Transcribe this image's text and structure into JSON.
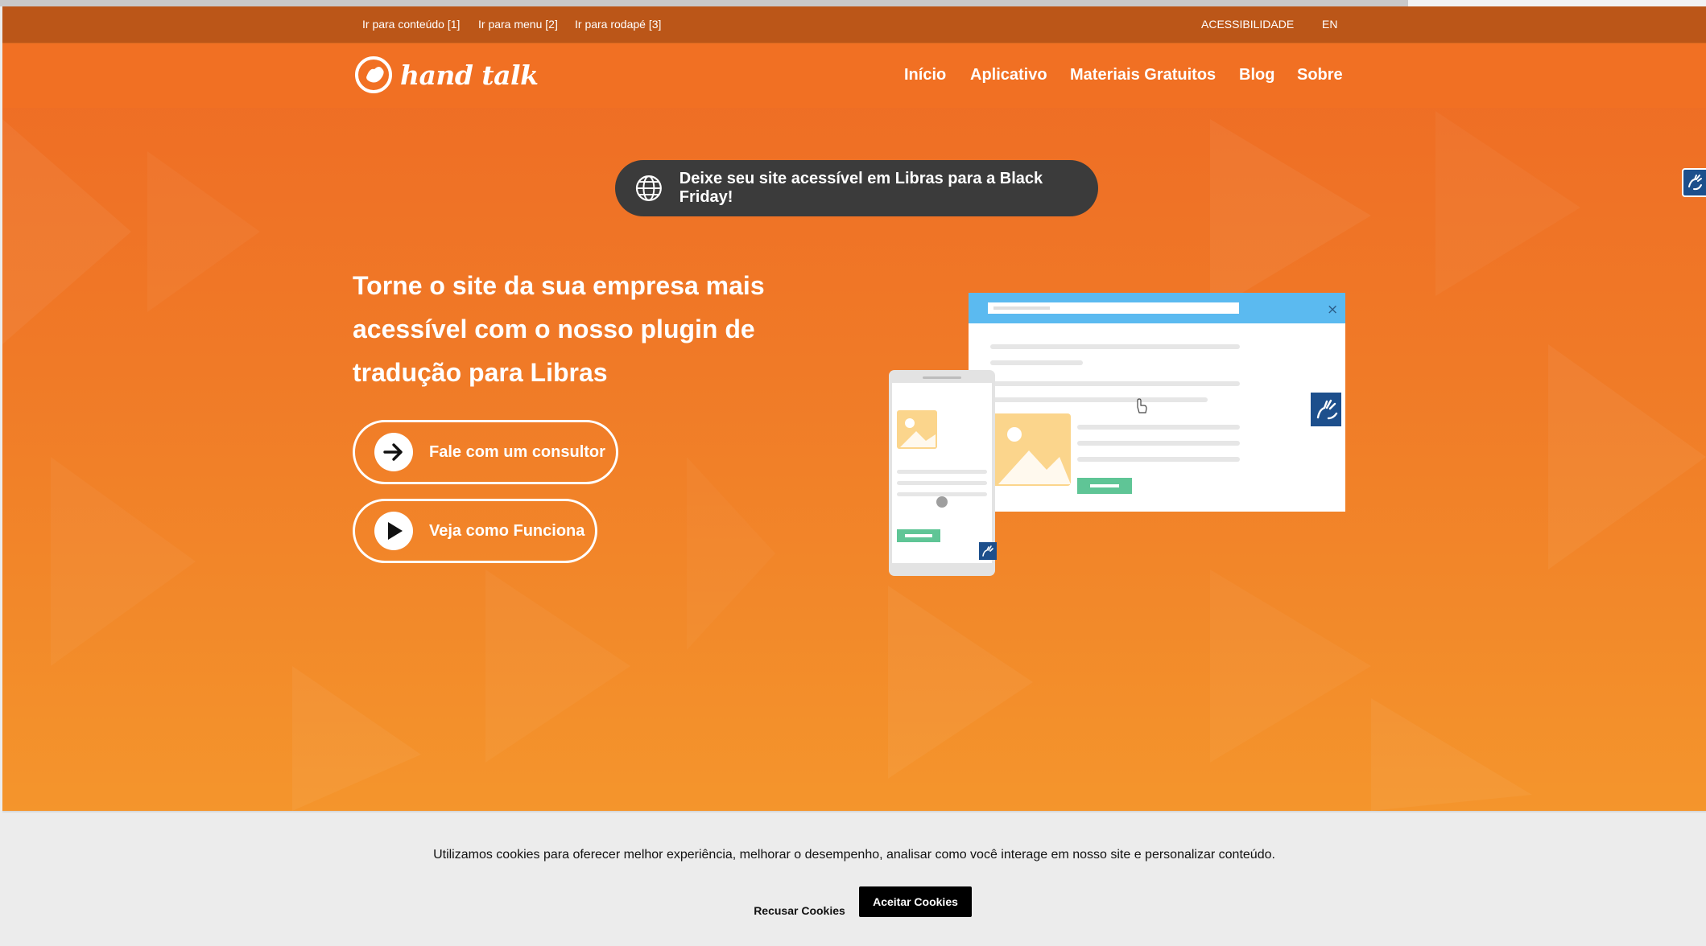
{
  "colors": {
    "utility_bar": "#bb5618",
    "nav_bar": "#f17023",
    "hero_top": "#ee6a24",
    "hero_bottom": "#f4952c",
    "promo_pill": "#3b3b3b",
    "browser_header": "#5bbaf0",
    "widget_blue": "#1d4f8c",
    "green_button": "#5fc596",
    "image_placeholder": "#fbd58c",
    "cookie_bg": "#ececec"
  },
  "utility": {
    "skip_content": "Ir para conteúdo [1]",
    "skip_menu": "Ir para menu [2]",
    "skip_footer": "Ir para rodapé [3]",
    "accessibility": "ACESSIBILIDADE",
    "language": "EN"
  },
  "logo": {
    "text": "hand talk",
    "icon": "hand-talk-logo-icon"
  },
  "nav": {
    "items": [
      {
        "label": "Início"
      },
      {
        "label": "Aplicativo"
      },
      {
        "label": "Materiais Gratuitos"
      },
      {
        "label": "Blog"
      },
      {
        "label": "Sobre"
      }
    ]
  },
  "promo": {
    "icon": "globe-icon",
    "text": "Deixe seu site acessível em Libras para a Black Friday!"
  },
  "hero": {
    "title_line1": "Torne o site da sua empresa mais",
    "title_line2": "acessível com o nosso plugin de",
    "title_line3": "tradução para Libras",
    "cta_primary": {
      "icon": "arrow-right-icon",
      "label": "Fale com um consultor"
    },
    "cta_secondary": {
      "icon": "play-icon",
      "label": "Veja como Funciona"
    }
  },
  "illustration": {
    "close_glyph": "×",
    "widget_icon": "sign-language-hands-icon"
  },
  "cookie": {
    "text": "Utilizamos cookies para oferecer melhor experiência, melhorar o desempenho, analisar como você interage em nosso site e personalizar conteúdo.",
    "refuse_label": "Recusar Cookies",
    "accept_label": "Aceitar Cookies"
  }
}
